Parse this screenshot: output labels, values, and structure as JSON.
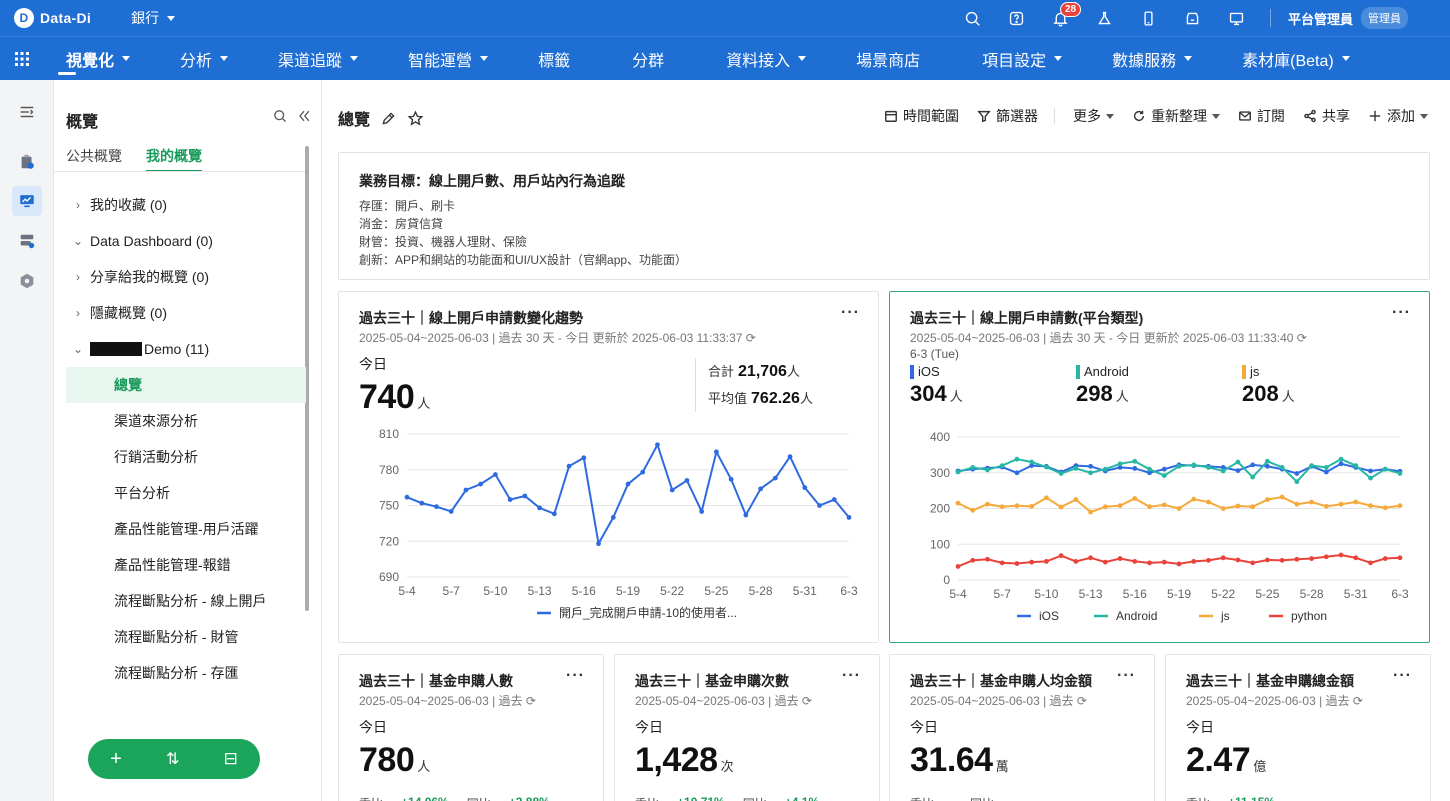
{
  "topbar": {
    "logo_mark": "D",
    "logo_text": "Data-Di",
    "bank": "銀行",
    "notifications_count": "28",
    "user_name": "平台管理員",
    "user_role": "管理員"
  },
  "nav": {
    "items": [
      {
        "label": "視覺化",
        "dropdown": true,
        "active": true
      },
      {
        "label": "分析",
        "dropdown": true
      },
      {
        "label": "渠道追蹤",
        "dropdown": true
      },
      {
        "label": "智能運營",
        "dropdown": true
      },
      {
        "label": "標籤",
        "dropdown": false
      },
      {
        "label": "分群",
        "dropdown": false
      },
      {
        "label": "資料接入",
        "dropdown": true
      },
      {
        "label": "場景商店",
        "dropdown": false
      },
      {
        "label": "項目設定",
        "dropdown": true
      },
      {
        "label": "數據服務",
        "dropdown": true
      },
      {
        "label": "素材庫(Beta)",
        "dropdown": true
      }
    ]
  },
  "sidebar": {
    "title": "概覽",
    "tabs": [
      "公共概覽",
      "我的概覽"
    ],
    "groups": [
      {
        "label": "我的收藏",
        "count": "(0)",
        "expanded": false
      },
      {
        "label": "Data Dashboard",
        "count": "(0)",
        "expanded": true
      },
      {
        "label": "分享給我的概覽",
        "count": "(0)",
        "expanded": false
      },
      {
        "label": "隱藏概覽",
        "count": "(0)",
        "expanded": false
      },
      {
        "label": "Demo",
        "count": "(11)",
        "expanded": true
      }
    ],
    "items": [
      "總覽",
      "渠道來源分析",
      "行銷活動分析",
      "平台分析",
      "產品性能管理-用戶活躍",
      "產品性能管理-報錯",
      "流程斷點分析 - 線上開戶",
      "流程斷點分析 - 財管",
      "流程斷點分析 - 存匯"
    ],
    "actions": [
      "+",
      "⇅",
      "⊟"
    ]
  },
  "main": {
    "title": "總覽",
    "toolbar": {
      "time_range": "時間範圍",
      "filter": "篩選器",
      "more": "更多",
      "refresh": "重新整理",
      "subscribe": "訂閱",
      "share": "共享",
      "add": "添加"
    },
    "goal": {
      "title": "業務目標：線上開戶數、用戶站內行為追蹤",
      "lines": [
        "存匯：開戶、刷卡",
        "消金：房貸信貸",
        "財管：投資、機器人理財、保險",
        "創新：APP和網站的功能面和UI/UX設計（官網app、功能面）"
      ]
    },
    "card1": {
      "title": "過去三十｜線上開戶申請數變化趨勢",
      "subtitle": "2025-05-04~2025-06-03 | 過去 30 天 - 今日 更新於 2025-06-03 11:33:37",
      "today_label": "今日",
      "today_value": "740",
      "unit": "人",
      "total_label": "合計",
      "total_value": "21,706",
      "avg_label": "平均值",
      "avg_value": "762.26"
    },
    "card2": {
      "title": "過去三十｜線上開戶申請數(平台類型)",
      "subtitle": "2025-05-04~2025-06-03 | 過去 30 天 - 今日 更新於 2025-06-03 11:33:40",
      "date_label": "6-3 (Tue)",
      "unit": "人",
      "platforms": [
        {
          "name": "iOS",
          "value": "304",
          "color": "#2f6be0"
        },
        {
          "name": "Android",
          "value": "298",
          "color": "#27b7a5"
        },
        {
          "name": "js",
          "value": "208",
          "color": "#f5a93a"
        }
      ]
    },
    "small_cards": [
      {
        "title": "過去三十｜基金申購人數",
        "subtitle": "2025-05-04~2025-06-03 | 過去",
        "today_label": "今日",
        "value": "780",
        "unit": "人",
        "qoq_label": "季比...",
        "qoq": "+14.06%",
        "yoy_label": "同比...",
        "yoy": "+2.88%"
      },
      {
        "title": "過去三十｜基金申購次數",
        "subtitle": "2025-05-04~2025-06-03 | 過去",
        "today_label": "今日",
        "value": "1,428",
        "unit": "次",
        "qoq_label": "季比...",
        "qoq": "+10.71%",
        "yoy_label": "同比...",
        "yoy": "+4.1%"
      },
      {
        "title": "過去三十｜基金申購人均金額",
        "subtitle": "2025-05-04~2025-06-03 | 過去",
        "today_label": "今日",
        "value": "31.64",
        "unit": "萬",
        "qoq_label": "季比...",
        "qoq": "",
        "yoy_label": "同比...",
        "yoy": ""
      },
      {
        "title": "過去三十｜基金申購總金額",
        "subtitle": "2025-05-04~2025-06-03 | 過去",
        "today_label": "今日",
        "value": "2.47",
        "unit": "億",
        "qoq_label": "季比...",
        "qoq": "+11.15%",
        "yoy_label": "",
        "yoy": ""
      }
    ]
  },
  "chart_data": [
    {
      "type": "line",
      "categories": [
        "5-4",
        "5-5",
        "5-6",
        "5-7",
        "5-8",
        "5-9",
        "5-10",
        "5-11",
        "5-12",
        "5-13",
        "5-14",
        "5-15",
        "5-16",
        "5-17",
        "5-18",
        "5-19",
        "5-20",
        "5-21",
        "5-22",
        "5-23",
        "5-24",
        "5-25",
        "5-26",
        "5-27",
        "5-28",
        "5-29",
        "5-30",
        "5-31",
        "6-1",
        "6-2",
        "6-3"
      ],
      "tick_labels": [
        "5-4",
        "5-7",
        "5-10",
        "5-13",
        "5-16",
        "5-19",
        "5-22",
        "5-25",
        "5-28",
        "5-31",
        "6-3"
      ],
      "ylim": [
        690,
        810
      ],
      "yticks": [
        690,
        720,
        750,
        780,
        810
      ],
      "series": [
        {
          "name": "開戶_完成開戶申請-10的使用者...",
          "color": "#2f6be0",
          "values": [
            757,
            752,
            749,
            745,
            763,
            768,
            776,
            755,
            758,
            748,
            743,
            783,
            790,
            718,
            740,
            768,
            778,
            801,
            763,
            771,
            745,
            795,
            772,
            742,
            764,
            773,
            791,
            765,
            750,
            755,
            740
          ]
        }
      ]
    },
    {
      "type": "line",
      "categories": [
        "5-4",
        "5-5",
        "5-6",
        "5-7",
        "5-8",
        "5-9",
        "5-10",
        "5-11",
        "5-12",
        "5-13",
        "5-14",
        "5-15",
        "5-16",
        "5-17",
        "5-18",
        "5-19",
        "5-20",
        "5-21",
        "5-22",
        "5-23",
        "5-24",
        "5-25",
        "5-26",
        "5-27",
        "5-28",
        "5-29",
        "5-30",
        "5-31",
        "6-1",
        "6-2",
        "6-3"
      ],
      "tick_labels": [
        "5-4",
        "5-7",
        "5-10",
        "5-13",
        "5-16",
        "5-19",
        "5-22",
        "5-25",
        "5-28",
        "5-31",
        "6-3"
      ],
      "ylim": [
        0,
        400
      ],
      "yticks": [
        0,
        100,
        200,
        300,
        400
      ],
      "series": [
        {
          "name": "iOS",
          "color": "#2f6be0",
          "values": [
            305,
            310,
            313,
            316,
            300,
            320,
            318,
            302,
            320,
            318,
            305,
            315,
            312,
            300,
            310,
            322,
            320,
            318,
            315,
            306,
            322,
            318,
            310,
            298,
            318,
            302,
            325,
            315,
            305,
            310,
            304
          ]
        },
        {
          "name": "Android",
          "color": "#27b7a5",
          "values": [
            302,
            315,
            308,
            320,
            338,
            330,
            316,
            298,
            312,
            300,
            310,
            325,
            332,
            310,
            292,
            318,
            322,
            315,
            305,
            330,
            288,
            332,
            315,
            275,
            320,
            315,
            338,
            320,
            285,
            310,
            298
          ]
        },
        {
          "name": "js",
          "color": "#f5a93a",
          "values": [
            215,
            195,
            212,
            205,
            208,
            206,
            230,
            204,
            225,
            190,
            205,
            208,
            228,
            205,
            210,
            200,
            226,
            218,
            200,
            207,
            205,
            225,
            232,
            212,
            218,
            206,
            212,
            218,
            208,
            202,
            208
          ]
        },
        {
          "name": "python",
          "color": "#e8423b",
          "values": [
            38,
            55,
            58,
            48,
            46,
            50,
            52,
            68,
            52,
            62,
            50,
            60,
            52,
            48,
            50,
            45,
            52,
            55,
            62,
            56,
            48,
            56,
            55,
            58,
            60,
            65,
            70,
            62,
            48,
            60,
            62
          ]
        }
      ]
    }
  ]
}
